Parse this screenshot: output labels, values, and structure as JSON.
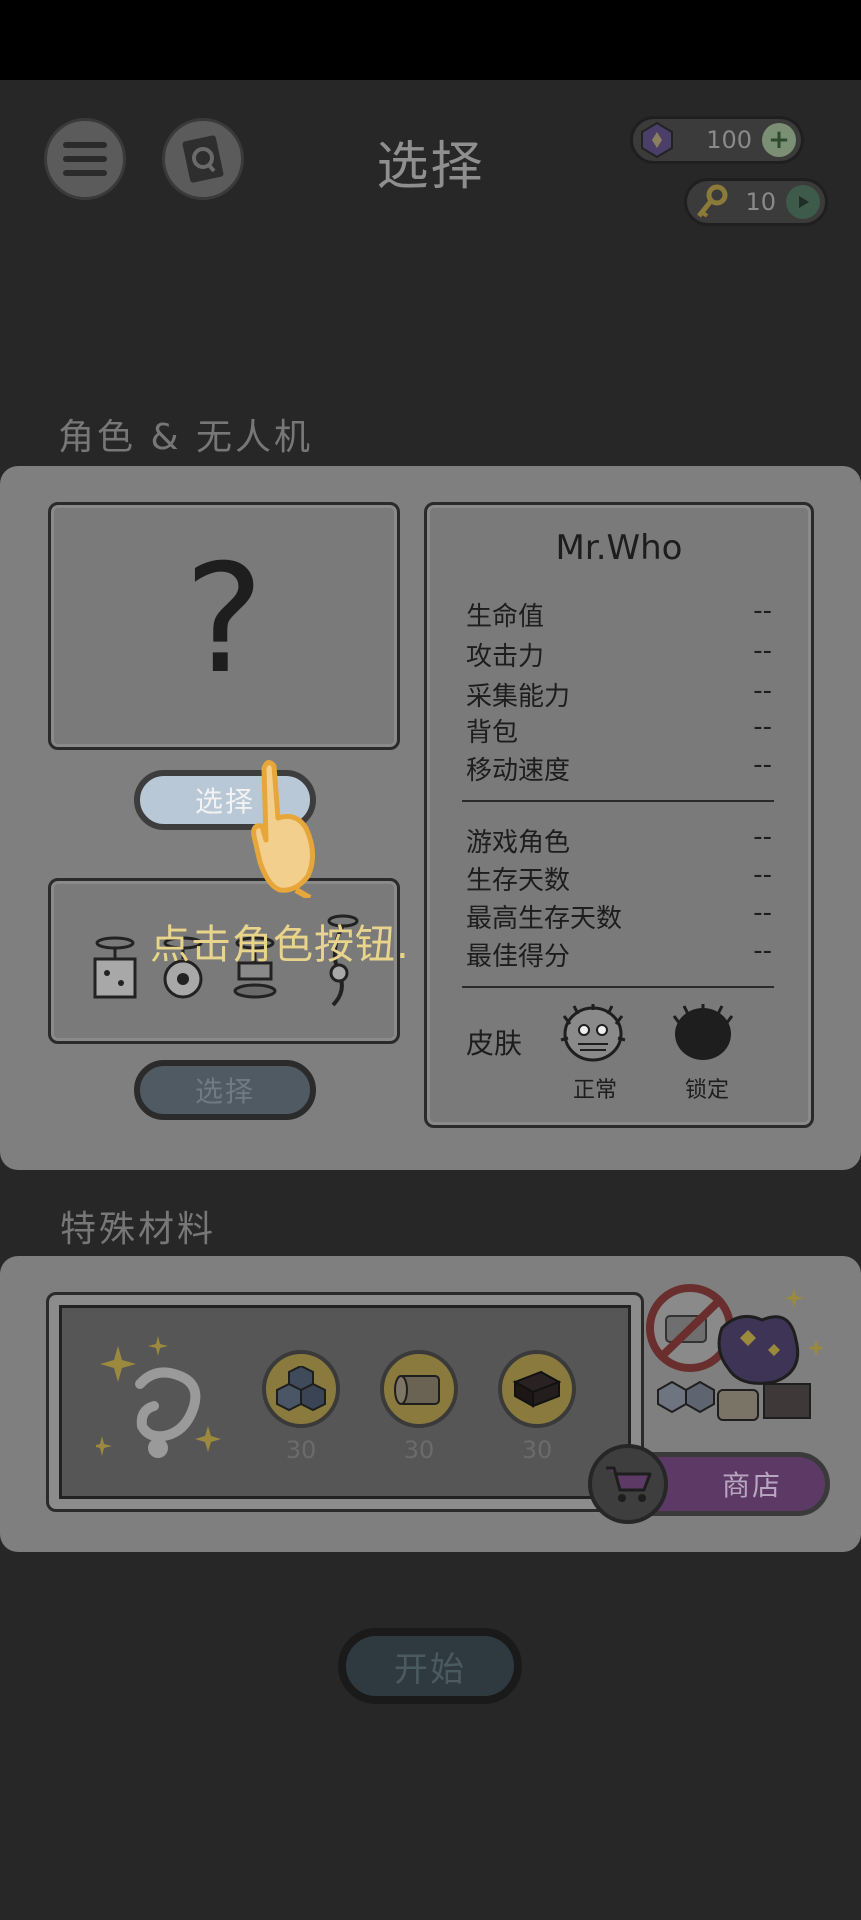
{
  "header": {
    "title": "选择",
    "menu_icon": "hamburger-menu-icon",
    "guide_icon": "quest-book-icon",
    "gems": {
      "value": "100",
      "icon": "purple-gem-icon",
      "action_icon": "plus-icon"
    },
    "keys": {
      "value": "10",
      "icon": "key-icon",
      "action_icon": "play-video-icon"
    }
  },
  "character_section": {
    "label": "角色 & 无人机",
    "character_placeholder": "?",
    "character_select_label": "选择",
    "drone_select_label": "选择",
    "tutorial_hint": "点击角色按钮.",
    "drone_icons": [
      "drone-box-icon",
      "drone-saw-icon",
      "drone-lamp-icon",
      "drone-claw-icon"
    ]
  },
  "info_card": {
    "name": "Mr.Who",
    "stats": [
      {
        "label": "生命值",
        "value": "--"
      },
      {
        "label": "攻击力",
        "value": "--"
      },
      {
        "label": "采集能力",
        "value": "--"
      },
      {
        "label": "背包",
        "value": "--"
      },
      {
        "label": "移动速度",
        "value": "--"
      }
    ],
    "records": [
      {
        "label": "游戏角色",
        "value": "--"
      },
      {
        "label": "生存天数",
        "value": "--"
      },
      {
        "label": "最高生存天数",
        "value": "--"
      },
      {
        "label": "最佳得分",
        "value": "--"
      }
    ],
    "skin_label": "皮肤",
    "skins": [
      {
        "label": "正常",
        "icon": "hairy-face-icon"
      },
      {
        "label": "锁定",
        "icon": "locked-silhouette-icon"
      }
    ]
  },
  "materials_section": {
    "label": "特殊材料",
    "items": [
      {
        "icon": "metal-ore-icon",
        "count": "30"
      },
      {
        "icon": "cloth-roll-icon",
        "count": "30"
      },
      {
        "icon": "dark-block-icon",
        "count": "30"
      }
    ],
    "shop_label": "商店",
    "shop_icon": "shopping-cart-icon",
    "no_ads_icon": "no-ads-icon"
  },
  "start_label": "开始",
  "colors": {
    "overlay_hint": "#e8d48a",
    "shop_purple": "#5d3a66",
    "select_highlight": "#b9c8d6"
  }
}
